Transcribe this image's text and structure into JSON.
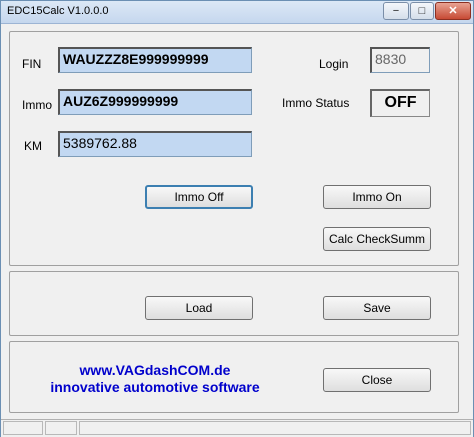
{
  "window": {
    "title": "EDC15Calc V1.0.0.0",
    "minimize": "−",
    "maximize": "□",
    "close": "✕"
  },
  "fields": {
    "fin_label": "FIN",
    "fin_value": "WAUZZZ8E999999999",
    "immo_label": "Immo",
    "immo_value": "AUZ6Z999999999",
    "km_label": "KM",
    "km_value": "5389762.88",
    "login_label": "Login",
    "login_value": "8830",
    "immo_status_label": "Immo Status",
    "immo_status_value": "OFF"
  },
  "buttons": {
    "immo_off": "Immo Off",
    "immo_on": "Immo On",
    "calc_checksum": "Calc CheckSumm",
    "load": "Load",
    "save": "Save",
    "close": "Close"
  },
  "footer": {
    "url": "www.VAGdashCOM.de",
    "tagline": "innovative automotive software"
  }
}
